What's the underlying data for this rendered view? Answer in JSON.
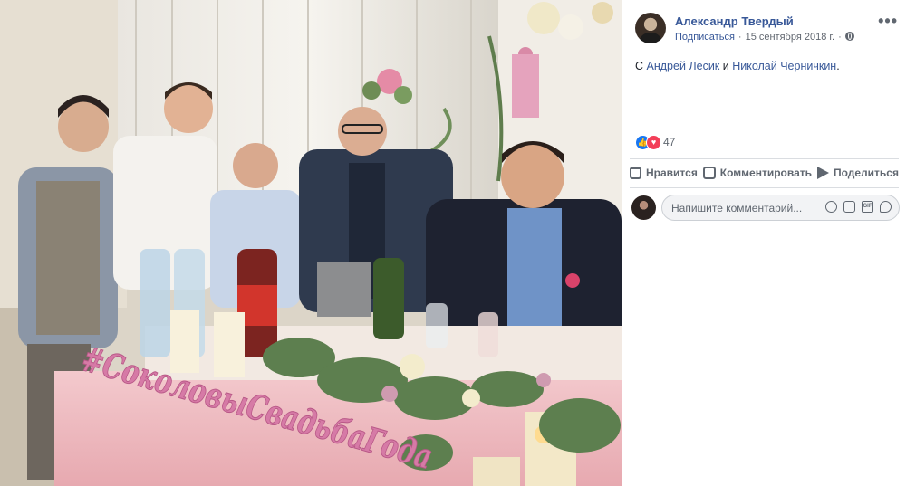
{
  "post": {
    "author": "Александр Твердый",
    "follow_label": "Подписаться",
    "separator": "·",
    "date": "15 сентября 2018 г.",
    "more": "•••",
    "tagline": {
      "prefix": "С",
      "person1": "Андрей Лесик",
      "conj": "и",
      "person2": "Николай Черничкин",
      "suffix": "."
    }
  },
  "reactions": {
    "count": "47",
    "like_glyph": "👍",
    "heart_glyph": "♥"
  },
  "actions": {
    "like": "Нравится",
    "comment": "Комментировать",
    "share": "Поделиться"
  },
  "comment_box": {
    "placeholder": "Напишите комментарий..."
  },
  "photo": {
    "sign_text": "#СоколовыСвадьбаГода"
  },
  "icons": {
    "globe": "globe-icon",
    "more": "more-icon",
    "like": "like-icon",
    "comment": "comment-icon",
    "share": "share-icon",
    "emoji": "emoji-icon",
    "camera": "camera-icon",
    "gif": "gif-icon",
    "sticker": "sticker-icon"
  },
  "colors": {
    "link": "#385898",
    "like_blue": "#1877f2",
    "heart_red": "#f33e58",
    "muted": "#606770"
  }
}
